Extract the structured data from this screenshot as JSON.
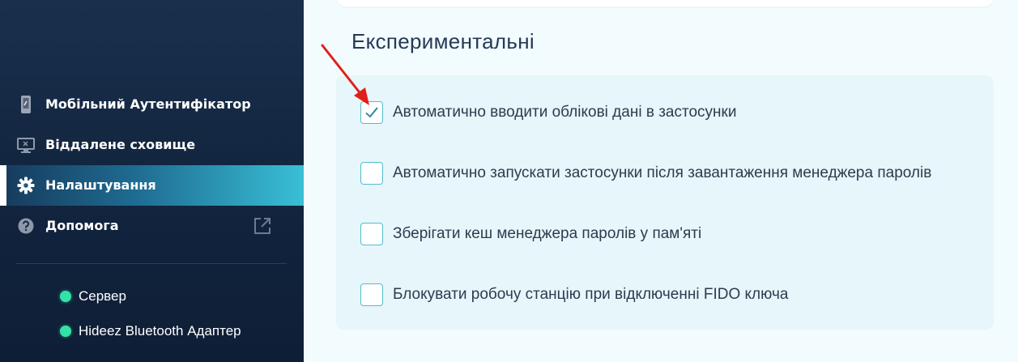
{
  "sidebar": {
    "items": [
      {
        "label": "Мобільний Аутентифікатор",
        "icon": "phone-key-icon"
      },
      {
        "label": "Віддалене сховище",
        "icon": "monitor-icon"
      },
      {
        "label": "Налаштування",
        "icon": "gear-icon",
        "active": true
      },
      {
        "label": "Допомога",
        "icon": "question-icon",
        "external": "external-link-icon"
      }
    ],
    "status": [
      {
        "label": "Сервер",
        "state": "connected"
      },
      {
        "label": "Hideez Bluetooth Адаптер",
        "state": "connected"
      }
    ]
  },
  "main": {
    "section_title": "Експериментальні",
    "options": [
      {
        "label": "Автоматично вводити облікові дані в застосунки",
        "checked": true
      },
      {
        "label": "Автоматично запускати застосунки після завантаження менеджера паролів",
        "checked": false
      },
      {
        "label": "Зберігати кеш менеджера паролів у пам'яті",
        "checked": false
      },
      {
        "label": "Блокувати робочу станцію при відключенні FIDO ключа",
        "checked": false
      }
    ]
  },
  "colors": {
    "sidebar_bg": "#132640",
    "accent": "#39bfd6",
    "status_dot": "#33e3a6",
    "annotation_arrow": "#e0201c"
  }
}
